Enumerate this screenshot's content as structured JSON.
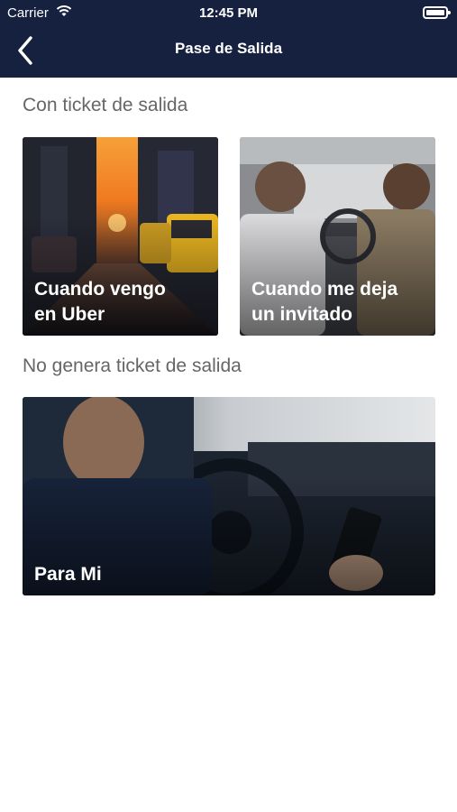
{
  "status_bar": {
    "carrier": "Carrier",
    "time": "12:45 PM"
  },
  "nav": {
    "title": "Pase de Salida",
    "back_icon": "chevron-left-icon"
  },
  "sections": [
    {
      "title": "Con ticket de salida",
      "cards": [
        {
          "label": "Cuando vengo\nen Uber"
        },
        {
          "label": "Cuando me deja\nun invitado"
        }
      ]
    },
    {
      "title": "No genera ticket de salida",
      "cards": [
        {
          "label": "Para Mi"
        }
      ]
    }
  ],
  "colors": {
    "header_bg": "#16203f",
    "section_title": "#666666",
    "card_text": "#ffffff"
  }
}
